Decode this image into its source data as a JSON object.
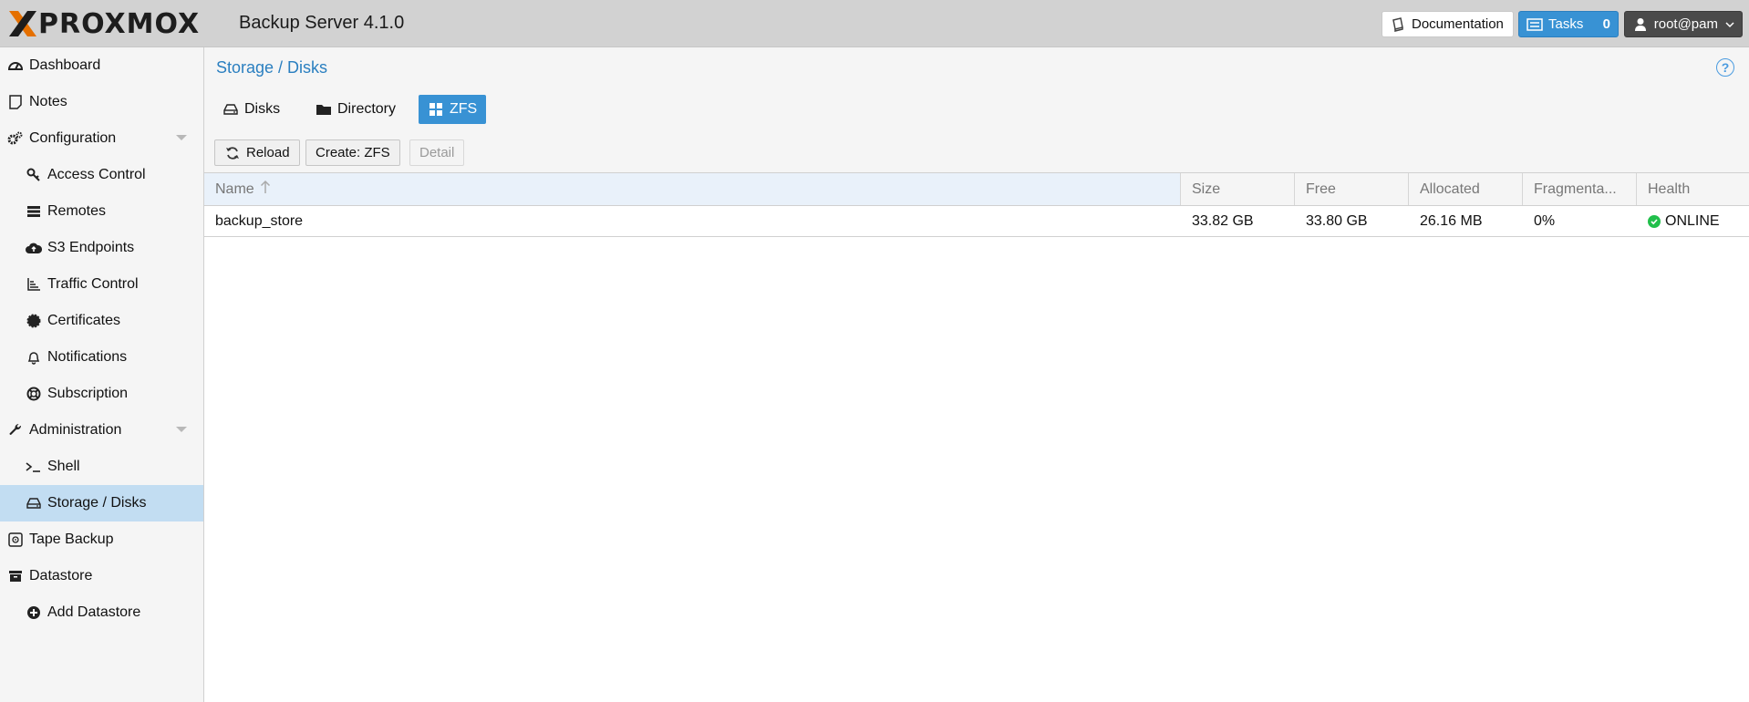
{
  "app": {
    "logo_text": "PROXMOX",
    "product_title": "Backup Server 4.1.0"
  },
  "topbar": {
    "documentation_label": "Documentation",
    "tasks_label": "Tasks",
    "tasks_count": "0",
    "user_label": "root@pam"
  },
  "sidebar": {
    "items": [
      {
        "label": "Dashboard",
        "icon": "dashboard-icon"
      },
      {
        "label": "Notes",
        "icon": "notes-icon"
      },
      {
        "label": "Configuration",
        "icon": "gears-icon"
      },
      {
        "label": "Access Control",
        "icon": "key-icon"
      },
      {
        "label": "Remotes",
        "icon": "server-icon"
      },
      {
        "label": "S3 Endpoints",
        "icon": "cloud-upload-icon"
      },
      {
        "label": "Traffic Control",
        "icon": "bar-chart-icon"
      },
      {
        "label": "Certificates",
        "icon": "certificate-icon"
      },
      {
        "label": "Notifications",
        "icon": "bell-icon"
      },
      {
        "label": "Subscription",
        "icon": "life-ring-icon"
      },
      {
        "label": "Administration",
        "icon": "wrench-icon"
      },
      {
        "label": "Shell",
        "icon": "terminal-icon"
      },
      {
        "label": "Storage / Disks",
        "icon": "hdd-icon"
      },
      {
        "label": "Tape Backup",
        "icon": "tape-icon"
      },
      {
        "label": "Datastore",
        "icon": "archive-icon"
      },
      {
        "label": "Add Datastore",
        "icon": "plus-circle-icon"
      }
    ],
    "selected": "Storage / Disks"
  },
  "main": {
    "title": "Storage / Disks",
    "tabs": [
      {
        "label": "Disks"
      },
      {
        "label": "Directory"
      },
      {
        "label": "ZFS"
      }
    ],
    "active_tab": "ZFS",
    "toolbar": {
      "reload_label": "Reload",
      "create_label": "Create: ZFS",
      "detail_label": "Detail"
    },
    "grid": {
      "columns": [
        "Name",
        "Size",
        "Free",
        "Allocated",
        "Fragmenta...",
        "Health"
      ],
      "sort_column": "Name",
      "sort_direction": "ascending",
      "rows": [
        {
          "name": "backup_store",
          "size": "33.82 GB",
          "free": "33.80 GB",
          "allocated": "26.16 MB",
          "fragmentation": "0%",
          "health": "ONLINE"
        }
      ]
    }
  },
  "colors": {
    "accent": "#3892d4",
    "title_link": "#2a7fc0",
    "selected_nav": "#c2ddf2",
    "health_ok": "#21bf4b",
    "logo_orange": "#e57000"
  }
}
